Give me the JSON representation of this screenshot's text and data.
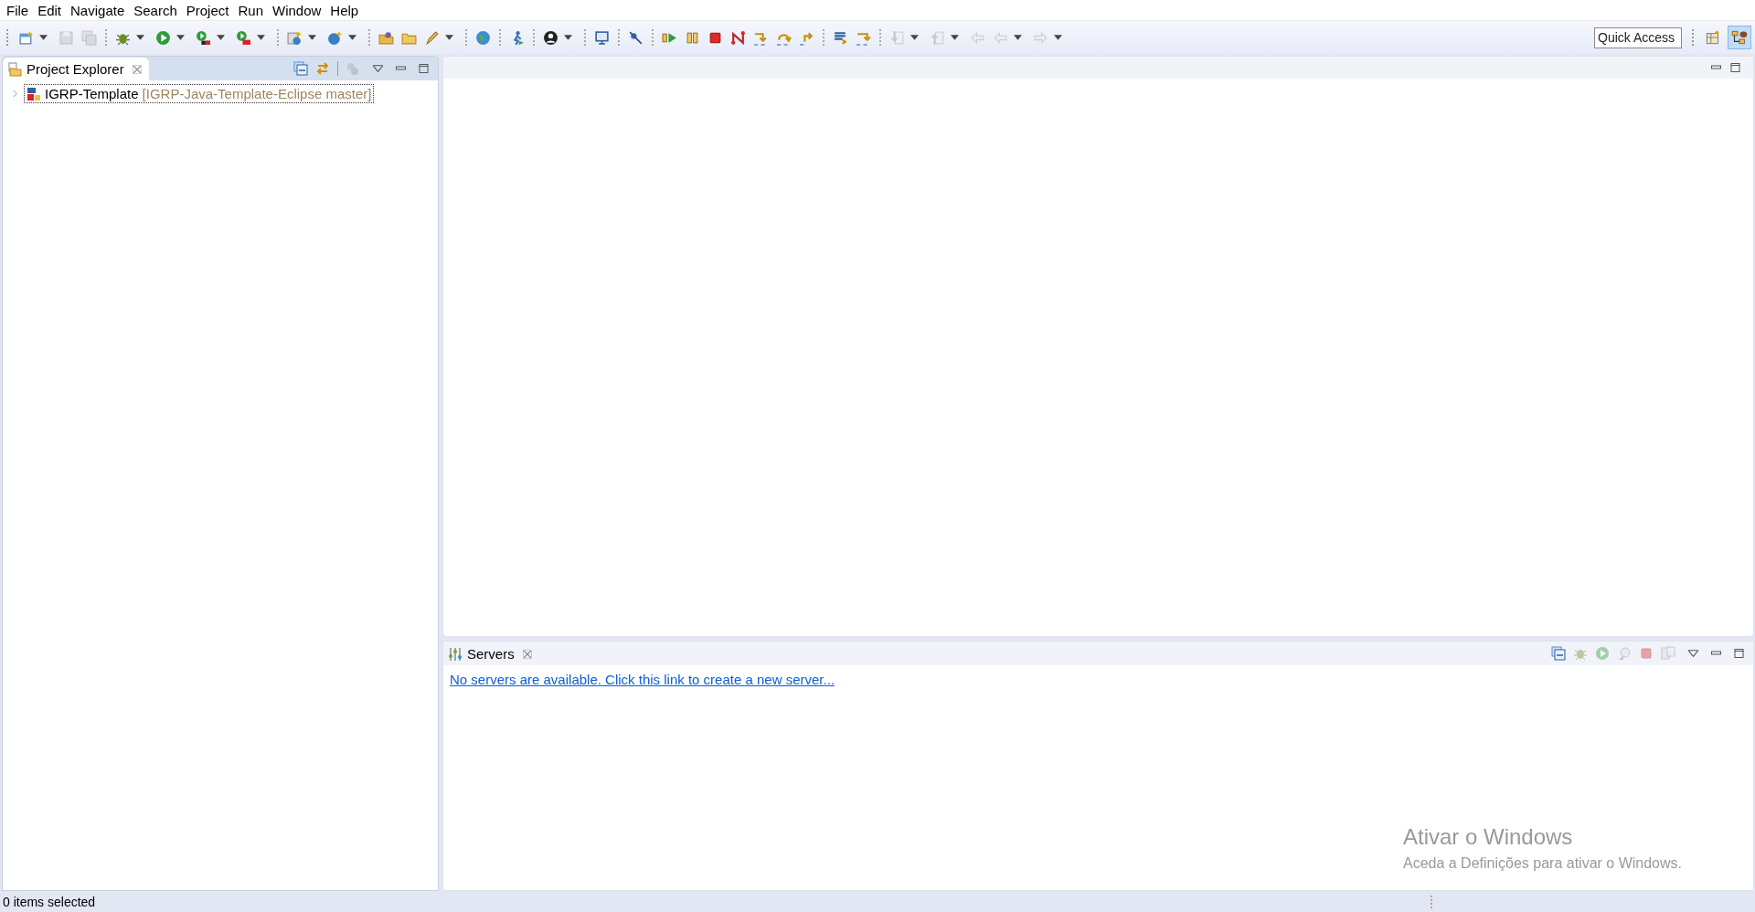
{
  "menu": [
    "File",
    "Edit",
    "Navigate",
    "Search",
    "Project",
    "Run",
    "Window",
    "Help"
  ],
  "toolbar": [
    {
      "kind": "new",
      "disabled": false,
      "dropdown": true
    },
    {
      "kind": "save",
      "disabled": true,
      "dropdown": false
    },
    {
      "kind": "save-all",
      "disabled": true,
      "dropdown": false
    },
    {
      "kind": "separator"
    },
    {
      "kind": "bug",
      "disabled": false,
      "dropdown": true
    },
    {
      "kind": "run",
      "disabled": false,
      "dropdown": true
    },
    {
      "kind": "coverage",
      "disabled": false,
      "dropdown": true
    },
    {
      "kind": "external",
      "disabled": false,
      "dropdown": true
    },
    {
      "kind": "separator"
    },
    {
      "kind": "new-server",
      "disabled": false,
      "dropdown": true
    },
    {
      "kind": "new-class",
      "disabled": false,
      "dropdown": true
    },
    {
      "kind": "separator"
    },
    {
      "kind": "folder-people",
      "disabled": false,
      "dropdown": false
    },
    {
      "kind": "folder",
      "disabled": false,
      "dropdown": false
    },
    {
      "kind": "pen",
      "disabled": false,
      "dropdown": true
    },
    {
      "kind": "separator"
    },
    {
      "kind": "globe",
      "disabled": false,
      "dropdown": false
    },
    {
      "kind": "separator"
    },
    {
      "kind": "runner",
      "disabled": false,
      "dropdown": false
    },
    {
      "kind": "separator"
    },
    {
      "kind": "person",
      "disabled": false,
      "dropdown": true
    },
    {
      "kind": "separator"
    },
    {
      "kind": "monitor",
      "disabled": false,
      "dropdown": false
    },
    {
      "kind": "separator"
    },
    {
      "kind": "pin",
      "disabled": false,
      "dropdown": false
    },
    {
      "kind": "separator"
    },
    {
      "kind": "resume",
      "disabled": false,
      "dropdown": false
    },
    {
      "kind": "pause",
      "disabled": false,
      "dropdown": false
    },
    {
      "kind": "stop",
      "disabled": false,
      "dropdown": false
    },
    {
      "kind": "disconnect",
      "disabled": false,
      "dropdown": false
    },
    {
      "kind": "step-into",
      "disabled": false,
      "dropdown": false
    },
    {
      "kind": "step-over",
      "disabled": false,
      "dropdown": false
    },
    {
      "kind": "step-return",
      "disabled": false,
      "dropdown": false
    },
    {
      "kind": "separator"
    },
    {
      "kind": "frames",
      "disabled": false,
      "dropdown": false
    },
    {
      "kind": "step-filter",
      "disabled": false,
      "dropdown": false
    },
    {
      "kind": "separator"
    },
    {
      "kind": "down-doc",
      "disabled": true,
      "dropdown": true
    },
    {
      "kind": "up-doc",
      "disabled": true,
      "dropdown": true
    },
    {
      "kind": "last-edit",
      "disabled": true,
      "dropdown": false
    },
    {
      "kind": "back",
      "disabled": true,
      "dropdown": true
    },
    {
      "kind": "forward",
      "disabled": true,
      "dropdown": true
    }
  ],
  "quick_access": {
    "placeholder": "Quick Access"
  },
  "perspectives": [
    {
      "kind": "open-perspective",
      "selected": false
    },
    {
      "kind": "java-ee",
      "selected": true
    }
  ],
  "project_explorer": {
    "tab": "Project Explorer",
    "tree": [
      {
        "label": "IGRP-Template",
        "decoration": "[IGRP-Java-Template-Eclipse master]",
        "expanded": false,
        "selected": true
      }
    ]
  },
  "servers": {
    "tab": "Servers",
    "link": "No servers are available. Click this link to create a new server...",
    "toolbar": [
      {
        "kind": "collapse",
        "disabled": false
      },
      {
        "kind": "bug",
        "disabled": true
      },
      {
        "kind": "run",
        "disabled": true
      },
      {
        "kind": "profile",
        "disabled": true
      },
      {
        "kind": "stop",
        "disabled": true
      },
      {
        "kind": "publish",
        "disabled": true
      }
    ]
  },
  "activation_notice": {
    "title": "Ativar o Windows",
    "text": "Aceda a Definições para ativar o Windows."
  },
  "status_bar": {
    "text": "0 items selected"
  }
}
